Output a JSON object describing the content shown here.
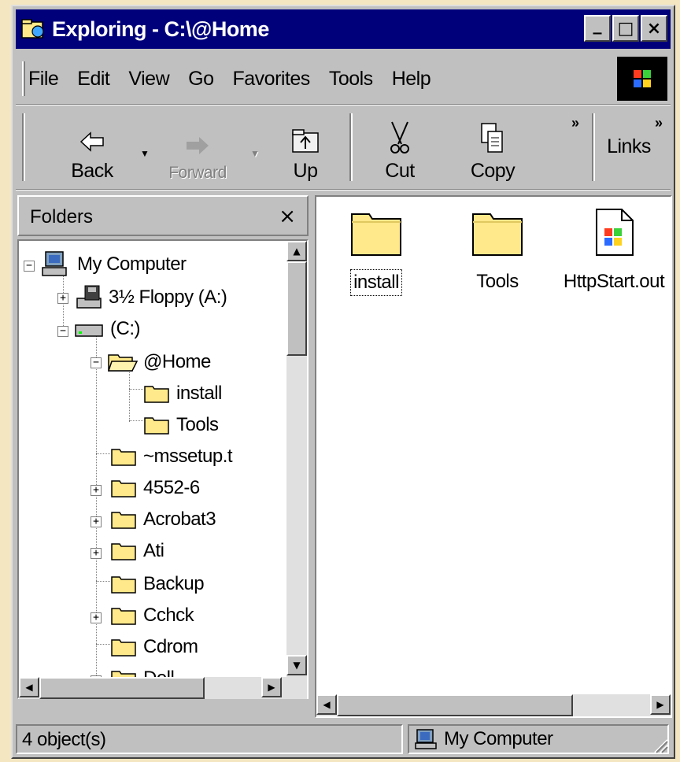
{
  "window": {
    "title": "Exploring - C:\\@Home"
  },
  "title_buttons": {
    "minimize": "_",
    "maximize": "□",
    "close": "×"
  },
  "menu": [
    "File",
    "Edit",
    "View",
    "Go",
    "Favorites",
    "Tools",
    "Help"
  ],
  "toolbar": {
    "back": "Back",
    "forward": "Forward",
    "up": "Up",
    "cut": "Cut",
    "copy": "Copy",
    "links": "Links",
    "more": "»"
  },
  "folders_panel": {
    "title": "Folders",
    "close": "×"
  },
  "tree": [
    {
      "label": "My Computer"
    },
    {
      "label": "3½ Floppy (A:)"
    },
    {
      "label": "(C:)"
    },
    {
      "label": "@Home"
    },
    {
      "label": "install"
    },
    {
      "label": "Tools"
    },
    {
      "label": "~mssetup.t"
    },
    {
      "label": "4552-6"
    },
    {
      "label": "Acrobat3"
    },
    {
      "label": "Ati"
    },
    {
      "label": "Backup"
    },
    {
      "label": "Cchck"
    },
    {
      "label": "Cdrom"
    },
    {
      "label": "Dell"
    }
  ],
  "files": [
    {
      "label": "install",
      "icon": "folder-icon"
    },
    {
      "label": "Tools",
      "icon": "folder-icon"
    },
    {
      "label": "HttpStart.out",
      "icon": "document-icon"
    }
  ],
  "status": {
    "objects": "4 object(s)",
    "location": "My Computer"
  },
  "colors": {
    "titlebar": "#00007b",
    "face": "#c0c0c0",
    "folder": "#ffe98a"
  }
}
